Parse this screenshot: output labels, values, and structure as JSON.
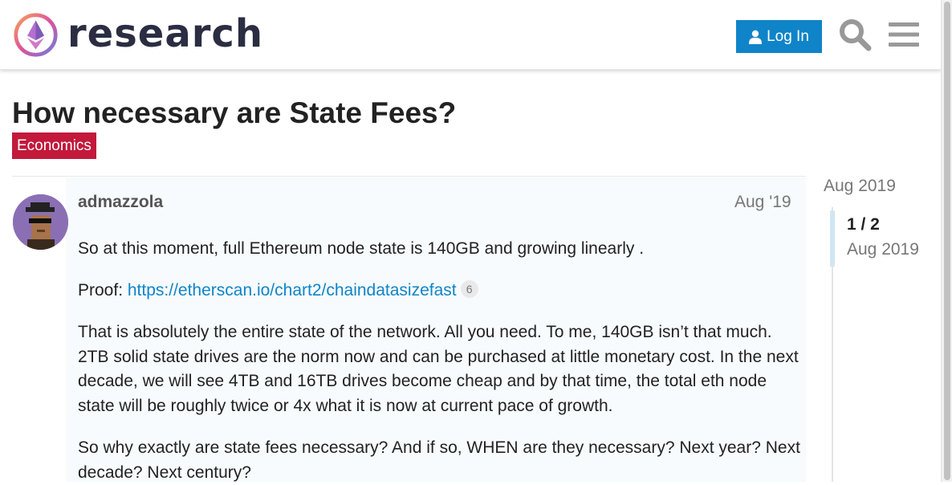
{
  "header": {
    "site_name": "research",
    "login_label": "Log In"
  },
  "topic": {
    "title": "How necessary are State Fees?",
    "category": "Economics"
  },
  "post": {
    "username": "admazzola",
    "date": "Aug '19",
    "p1": "So at this moment, full Ethereum node state is 140GB and growing linearly .",
    "proof_label": "Proof: ",
    "proof_link": "https://etherscan.io/chart2/chaindatasizefast",
    "proof_clicks": "6",
    "p3": "That is absolutely the entire state of the network. All you need. To me, 140GB isn’t that much. 2TB solid state drives are the norm now and can be purchased at little monetary cost. In the next decade, we will see 4TB and 16TB drives become cheap and by that time, the total eth node state will be roughly twice or 4x what it is now at current pace of growth.",
    "p4": "So why exactly are state fees necessary? And if so, WHEN are they necessary? Next year? Next decade? Next century?"
  },
  "timeline": {
    "start_date": "Aug 2019",
    "position": "1 / 2",
    "current_date": "Aug 2019"
  },
  "colors": {
    "accent": "#0f84c8",
    "category": "#c3193b"
  },
  "icons": [
    "ethereum-logo-icon",
    "user-icon",
    "search-icon",
    "hamburger-menu-icon"
  ]
}
